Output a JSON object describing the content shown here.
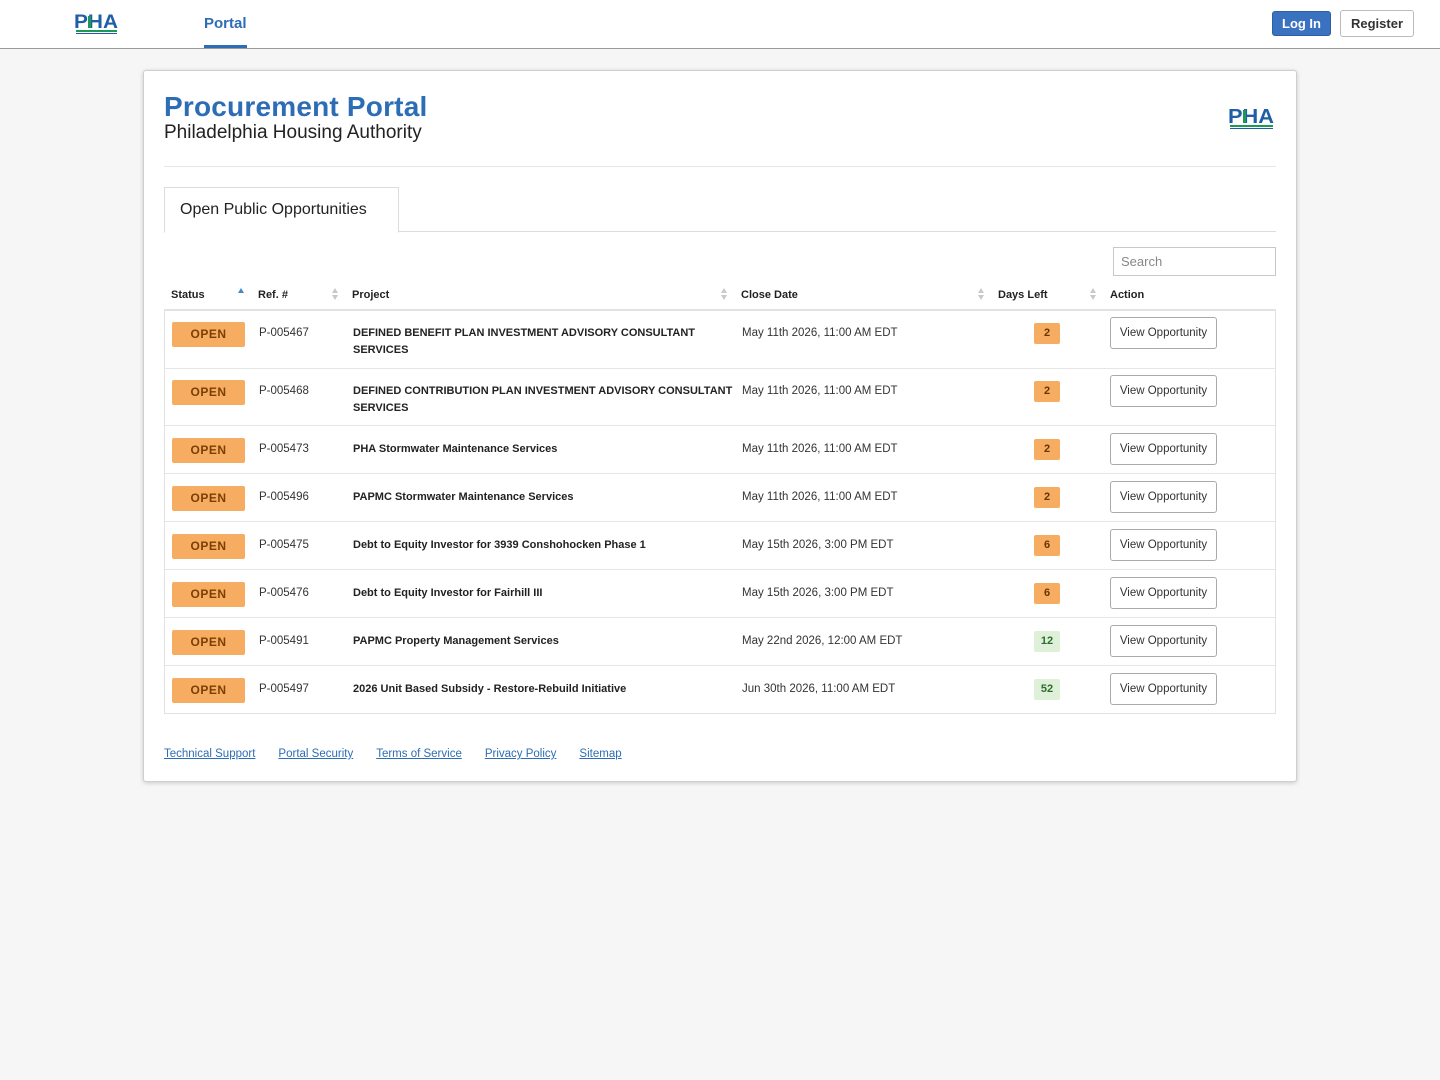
{
  "nav": {
    "logo_text": "PHA",
    "tab_label": "Portal",
    "login_label": "Log In",
    "register_label": "Register"
  },
  "header": {
    "title": "Procurement Portal",
    "subtitle": "Philadelphia Housing Authority",
    "logo_text": "PHA"
  },
  "tab": {
    "label": "Open Public Opportunities"
  },
  "search": {
    "placeholder": "Search"
  },
  "table": {
    "columns": [
      "Status",
      "Ref. #",
      "Project",
      "Close Date",
      "Days Left",
      "Action"
    ],
    "rows": [
      {
        "status": "OPEN",
        "ref": "P-005467",
        "project": "DEFINED BENEFIT PLAN INVESTMENT ADVISORY CONSULTANT SERVICES",
        "close_date": "May 11th 2026, 11:00 AM EDT",
        "days_left": "2",
        "action": "View Opportunity"
      },
      {
        "status": "OPEN",
        "ref": "P-005468",
        "project": "DEFINED CONTRIBUTION PLAN INVESTMENT ADVISORY CONSULTANT SERVICES",
        "close_date": "May 11th 2026, 11:00 AM EDT",
        "days_left": "2",
        "action": "View Opportunity"
      },
      {
        "status": "OPEN",
        "ref": "P-005473",
        "project": "PHA Stormwater Maintenance Services",
        "close_date": "May 11th 2026, 11:00 AM EDT",
        "days_left": "2",
        "action": "View Opportunity"
      },
      {
        "status": "OPEN",
        "ref": "P-005496",
        "project": "PAPMC Stormwater Maintenance Services",
        "close_date": "May 11th 2026, 11:00 AM EDT",
        "days_left": "2",
        "action": "View Opportunity"
      },
      {
        "status": "OPEN",
        "ref": "P-005475",
        "project": "Debt to Equity Investor for 3939 Conshohocken Phase 1",
        "close_date": "May 15th 2026, 3:00 PM EDT",
        "days_left": "6",
        "action": "View Opportunity"
      },
      {
        "status": "OPEN",
        "ref": "P-005476",
        "project": "Debt to Equity Investor for Fairhill III",
        "close_date": "May 15th 2026, 3:00 PM EDT",
        "days_left": "6",
        "action": "View Opportunity"
      },
      {
        "status": "OPEN",
        "ref": "P-005491",
        "project": "PAPMC Property Management Services",
        "close_date": "May 22nd 2026, 12:00 AM EDT",
        "days_left": "12",
        "action": "View Opportunity"
      },
      {
        "status": "OPEN",
        "ref": "P-005497",
        "project": "2026 Unit Based Subsidy - Restore-Rebuild Initiative",
        "close_date": "Jun 30th 2026, 11:00 AM EDT",
        "days_left": "52",
        "action": "View Opportunity"
      }
    ]
  },
  "footer": {
    "links": [
      "Technical Support",
      "Portal Security",
      "Terms of Service",
      "Privacy Policy",
      "Sitemap"
    ]
  },
  "colors": {
    "primary": "#2d6db5",
    "open_badge": "#f6ad62",
    "days_warn": "#f6ad62",
    "days_ok": "#def0d8",
    "logo_blue": "#1f5fa6",
    "logo_green": "#1a9a54"
  }
}
